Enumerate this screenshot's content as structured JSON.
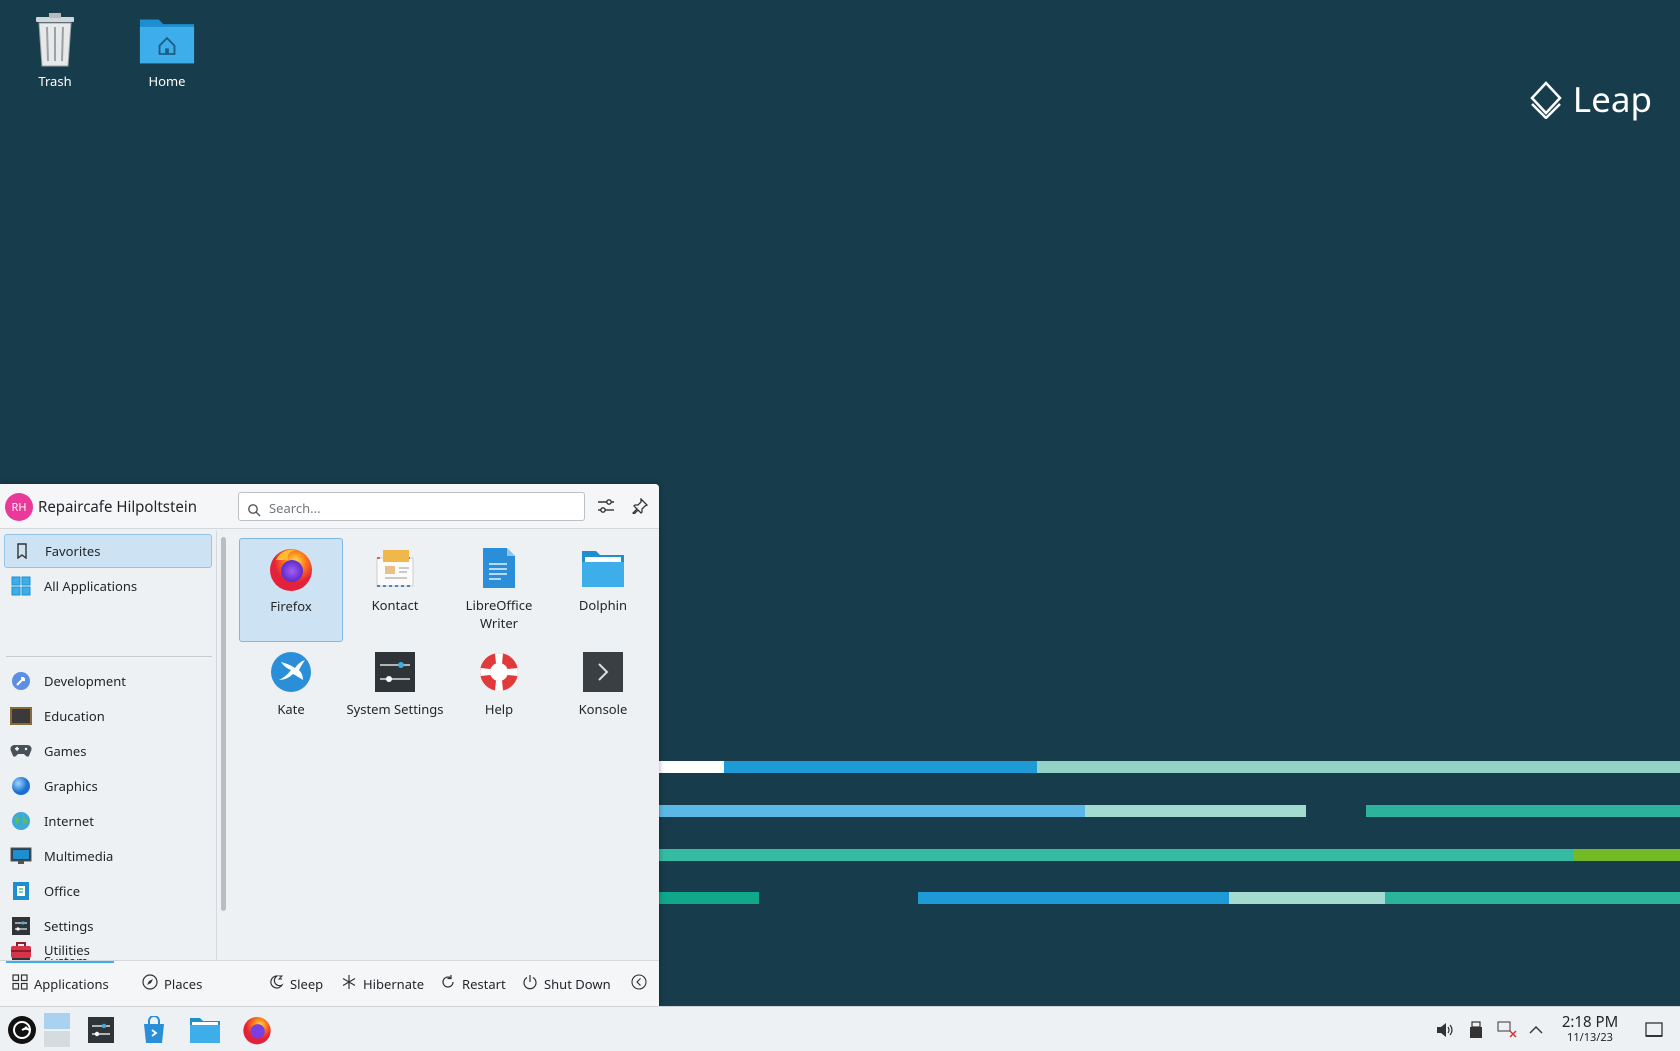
{
  "desktop": {
    "icons": [
      {
        "label": "Trash",
        "icon": "trash-icon"
      },
      {
        "label": "Home",
        "icon": "home-folder-icon"
      }
    ],
    "brand": "Leap"
  },
  "launcher": {
    "user": {
      "initials": "RH",
      "name": "Repaircafe Hilpoltstein"
    },
    "search": {
      "placeholder": "Search..."
    },
    "categories": [
      {
        "label": "Favorites",
        "icon": "bookmark-icon"
      },
      {
        "label": "All Applications",
        "icon": "grid-icon"
      },
      {
        "label": "Development",
        "icon": "development-icon"
      },
      {
        "label": "Education",
        "icon": "education-icon"
      },
      {
        "label": "Games",
        "icon": "gamepad-icon"
      },
      {
        "label": "Graphics",
        "icon": "graphics-icon"
      },
      {
        "label": "Internet",
        "icon": "globe-icon"
      },
      {
        "label": "Multimedia",
        "icon": "multimedia-icon"
      },
      {
        "label": "Office",
        "icon": "office-icon"
      },
      {
        "label": "Settings",
        "icon": "settings-icon"
      },
      {
        "label": "System",
        "icon": "system-icon"
      },
      {
        "label": "Utilities",
        "icon": "toolbox-icon"
      }
    ],
    "apps": [
      {
        "label": "Firefox",
        "icon": "firefox-icon"
      },
      {
        "label": "Kontact",
        "icon": "kontact-icon"
      },
      {
        "label": "LibreOffice Writer",
        "icon": "writer-icon"
      },
      {
        "label": "Dolphin",
        "icon": "dolphin-icon"
      },
      {
        "label": "Kate",
        "icon": "kate-icon"
      },
      {
        "label": "System Settings",
        "icon": "system-settings-icon"
      },
      {
        "label": "Help",
        "icon": "help-icon"
      },
      {
        "label": "Konsole",
        "icon": "konsole-icon"
      }
    ],
    "footer": {
      "applications": "Applications",
      "places": "Places",
      "sleep": "Sleep",
      "hibernate": "Hibernate",
      "restart": "Restart",
      "shutdown": "Shut Down"
    }
  },
  "taskbar": {
    "time": "2:18 PM",
    "date": "11/13/23"
  },
  "colors": {
    "desktop_bg": "#173d4d",
    "accent": "#3daee9",
    "stripe_blue": "#1e9ad6",
    "stripe_light": "#92d3c8",
    "stripe_teal": "#2cb39c",
    "stripe_green": "#73ba25"
  }
}
